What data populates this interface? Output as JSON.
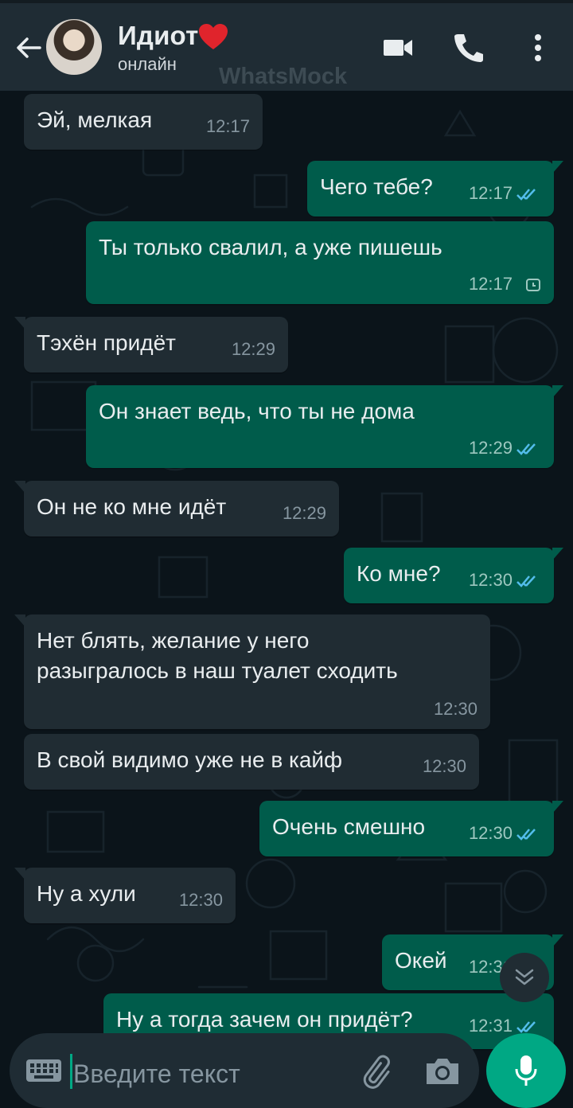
{
  "header": {
    "contact_name": "Идиот",
    "status": "онлайн",
    "watermark": "WhatsMock",
    "icons": [
      "back-arrow-icon",
      "video-call-icon",
      "phone-icon",
      "more-vert-icon",
      "heart-icon"
    ]
  },
  "messages": [
    {
      "dir": "in",
      "text": "Эй, мелкая",
      "time": "12:17"
    },
    {
      "dir": "out",
      "text": "Чего тебе?",
      "time": "12:17",
      "status": "read"
    },
    {
      "dir": "out",
      "text": "Ты только свалил, а уже пишешь",
      "time": "12:17",
      "status": "pending"
    },
    {
      "dir": "in",
      "text": "Тэхён придёт",
      "time": "12:29"
    },
    {
      "dir": "out",
      "text": "Он знает ведь, что ты не дома",
      "time": "12:29",
      "status": "read"
    },
    {
      "dir": "in",
      "text": "Он не ко мне идёт",
      "time": "12:29"
    },
    {
      "dir": "out",
      "text": "Ко мне?",
      "time": "12:30",
      "status": "read"
    },
    {
      "dir": "in",
      "text": "Нет блять, желание у него\nразыгралось в наш туалет сходить",
      "time": "12:30"
    },
    {
      "dir": "in",
      "text": "В свой видимо уже не в кайф",
      "time": "12:30"
    },
    {
      "dir": "out",
      "text": "Очень смешно",
      "time": "12:30",
      "status": "read"
    },
    {
      "dir": "in",
      "text": "Ну а хули",
      "time": "12:30"
    },
    {
      "dir": "out",
      "text": "Окей",
      "time": "12:31",
      "status": "read"
    },
    {
      "dir": "out",
      "text": "Ну а тогда зачем он придёт?",
      "time": "12:31",
      "status": "read"
    }
  ],
  "composer": {
    "placeholder": "Введите текст",
    "icons": [
      "keyboard-icon",
      "attach-icon",
      "camera-icon",
      "mic-icon"
    ]
  },
  "colors": {
    "background": "#0b141a",
    "header": "#1f2c34",
    "incoming_bubble": "#202c33",
    "outgoing_bubble": "#005c4b",
    "accent": "#00a884",
    "read_tick": "#53bdeb"
  }
}
